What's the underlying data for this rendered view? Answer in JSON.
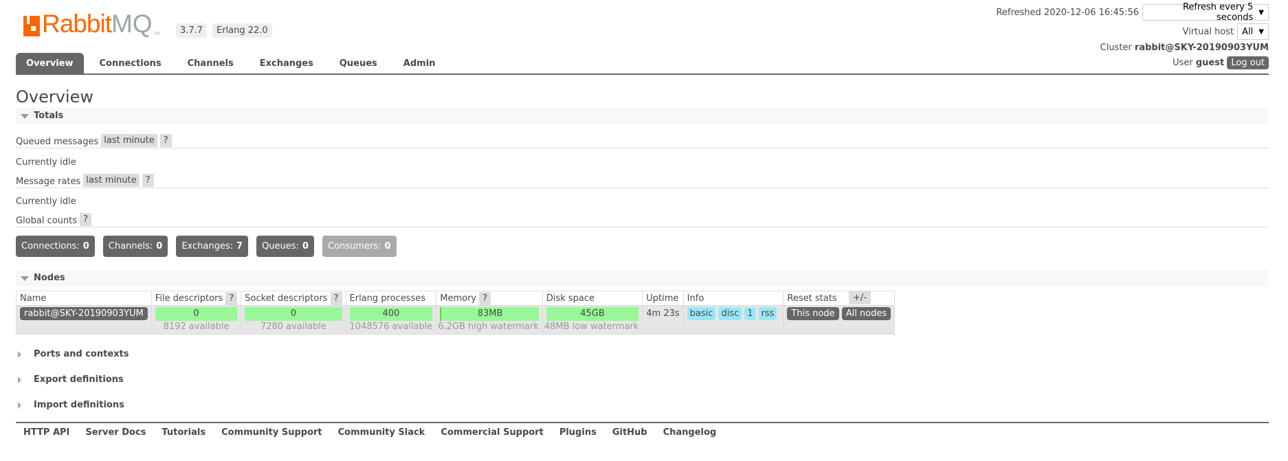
{
  "header": {
    "logo_text_1": "Rabbit",
    "logo_text_2": "MQ",
    "version": "3.7.7",
    "erlang": "Erlang 22.0",
    "refreshed_label": "Refreshed 2020-12-06 16:45:56",
    "refresh_select": "Refresh every 5 seconds",
    "vhost_label": "Virtual host",
    "vhost_value": "All",
    "cluster_label": "Cluster",
    "cluster_value": "rabbit@SKY-20190903YUM",
    "user_label": "User",
    "user_value": "guest",
    "logout": "Log out"
  },
  "tabs": [
    "Overview",
    "Connections",
    "Channels",
    "Exchanges",
    "Queues",
    "Admin"
  ],
  "page_title": "Overview",
  "totals": {
    "title": "Totals",
    "queued_label": "Queued messages",
    "queued_range": "last minute",
    "help": "?",
    "queued_status": "Currently idle",
    "rates_label": "Message rates",
    "rates_range": "last minute",
    "rates_status": "Currently idle",
    "global_label": "Global counts",
    "counts": [
      {
        "label": "Connections:",
        "value": "0"
      },
      {
        "label": "Channels:",
        "value": "0"
      },
      {
        "label": "Exchanges:",
        "value": "7"
      },
      {
        "label": "Queues:",
        "value": "0"
      },
      {
        "label": "Consumers:",
        "value": "0"
      }
    ]
  },
  "nodes": {
    "title": "Nodes",
    "columns": [
      "Name",
      "File descriptors",
      "Socket descriptors",
      "Erlang processes",
      "Memory",
      "Disk space",
      "Uptime",
      "Info",
      "Reset stats"
    ],
    "toggle": "+/-",
    "row": {
      "name": "rabbit@SKY-20190903YUM",
      "fd": "0",
      "fd_avail": "8192 available",
      "sd": "0",
      "sd_avail": "7280 available",
      "ep": "400",
      "ep_avail": "1048576 available",
      "mem": "83MB",
      "mem_sub": "6.2GB high watermark",
      "disk": "45GB",
      "disk_sub": "48MB low watermark",
      "uptime": "4m 23s",
      "info": [
        "basic",
        "disc",
        "1",
        "rss"
      ],
      "reset_this": "This node",
      "reset_all": "All nodes"
    }
  },
  "collapsed": [
    "Ports and contexts",
    "Export definitions",
    "Import definitions"
  ],
  "footer": [
    "HTTP API",
    "Server Docs",
    "Tutorials",
    "Community Support",
    "Community Slack",
    "Commercial Support",
    "Plugins",
    "GitHub",
    "Changelog"
  ]
}
